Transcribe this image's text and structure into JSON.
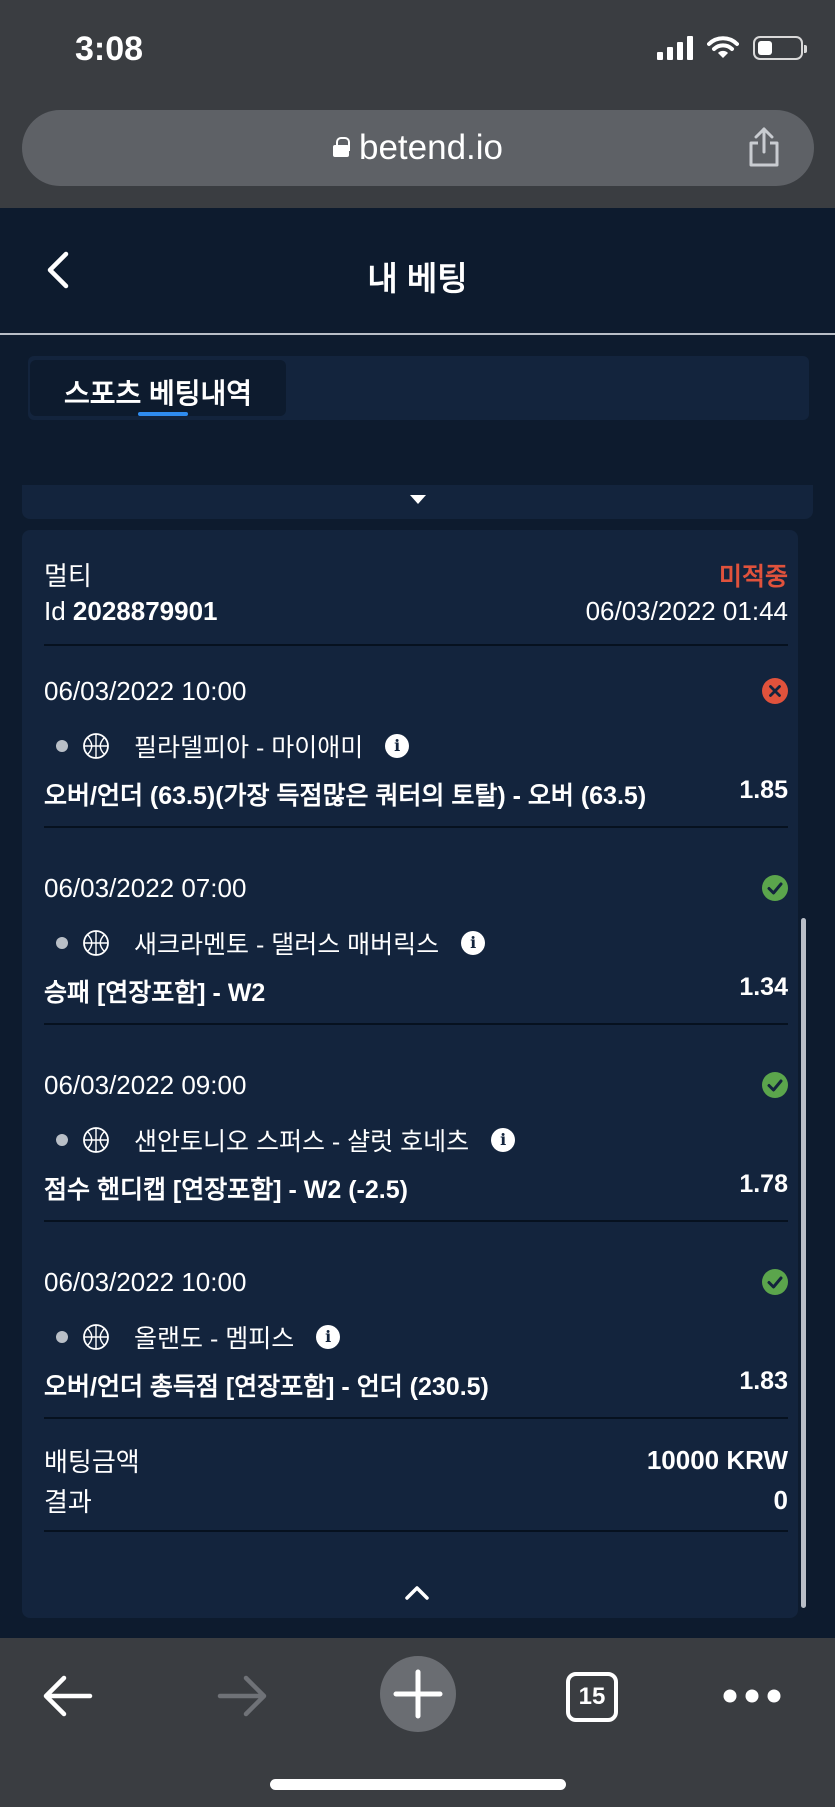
{
  "status_bar": {
    "time": "3:08"
  },
  "browser": {
    "url": "betend.io",
    "tab_count": "15"
  },
  "header": {
    "title": "내 베팅"
  },
  "tabs": [
    {
      "label": "스포츠 베팅내역",
      "active": true
    }
  ],
  "bet": {
    "type": "멀티",
    "status": "미적중",
    "id_label": "Id",
    "id_value": "2028879901",
    "placed_at": "06/03/2022 01:44",
    "selections": [
      {
        "time": "06/03/2022 10:00",
        "result": "lose",
        "teams": "필라델피아 - 마이애미",
        "market": "오버/언더 (63.5)(가장 득점많은 쿼터의 토탈) - 오버 (63.5)",
        "odds": "1.85"
      },
      {
        "time": "06/03/2022 07:00",
        "result": "win",
        "teams": "새크라멘토 - 댈러스 매버릭스",
        "market": "승패 [연장포함] - W2",
        "odds": "1.34"
      },
      {
        "time": "06/03/2022 09:00",
        "result": "win",
        "teams": "샌안토니오 스퍼스 - 샬럿 호네츠",
        "market": "점수 핸디캡 [연장포함] - W2 (-2.5)",
        "odds": "1.78"
      },
      {
        "time": "06/03/2022 10:00",
        "result": "win",
        "teams": "올랜도 - 멤피스",
        "market": "오버/언더 총득점 [연장포함] - 언더 (230.5)",
        "odds": "1.83"
      }
    ],
    "stake_label": "배팅금액",
    "stake_value": "10000 KRW",
    "result_label": "결과",
    "result_value": "0"
  },
  "colors": {
    "background": "#0d1b2e",
    "card": "#13243d",
    "lose": "#e0523c",
    "win": "#5ba54c",
    "accent": "#2f8cf0"
  }
}
